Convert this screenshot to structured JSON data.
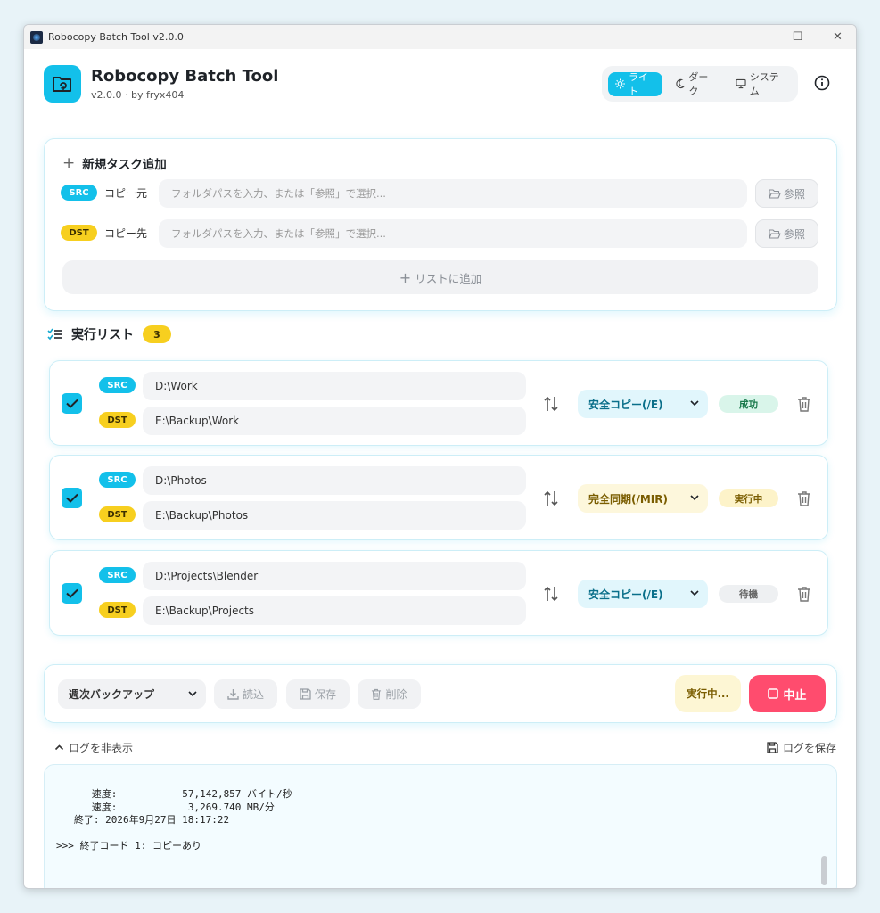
{
  "window": {
    "title": "Robocopy Batch Tool  v2.0.0"
  },
  "header": {
    "title": "Robocopy Batch Tool",
    "subtitle": "v2.0.0 · by fryx404",
    "themes": [
      {
        "label": "ライト",
        "icon": "sun-icon",
        "active": true
      },
      {
        "label": "ダーク",
        "icon": "moon-icon",
        "active": false
      },
      {
        "label": "システム",
        "icon": "monitor-icon",
        "active": false
      }
    ]
  },
  "new_task": {
    "title": "新規タスク追加",
    "src_badge": "SRC",
    "src_label": "コピー元",
    "src_placeholder": "フォルダパスを入力、または「参照」で選択...",
    "dst_badge": "DST",
    "dst_label": "コピー先",
    "dst_placeholder": "フォルダパスを入力、または「参照」で選択...",
    "browse_label": "参照",
    "add_label": "リストに追加"
  },
  "list": {
    "title": "実行リスト",
    "count": "3",
    "jobs": [
      {
        "checked": true,
        "src": "D:\\Work",
        "dst": "E:\\Backup\\Work",
        "mode": "安全コピー(/E)",
        "status": "成功"
      },
      {
        "checked": true,
        "src": "D:\\Photos",
        "dst": "E:\\Backup\\Photos",
        "mode": "完全同期(/MIR)",
        "status": "実行中"
      },
      {
        "checked": true,
        "src": "D:\\Projects\\Blender",
        "dst": "E:\\Backup\\Projects",
        "mode": "安全コピー(/E)",
        "status": "待機"
      }
    ]
  },
  "bottom": {
    "preset": "週次バックアップ",
    "load_label": "読込",
    "save_label": "保存",
    "delete_label": "削除",
    "running_label": "実行中...",
    "stop_label": "中止"
  },
  "log": {
    "toggle_label": "ログを非表示",
    "save_label": "ログを保存",
    "lines": "      速度:           57,142,857 バイト/秒\n      速度:            3,269.740 MB/分\n   終了: 2026年9月27日 18:17:22\n\n>>> 終了コード 1: コピーあり"
  },
  "colors": {
    "accent": "#13c0ea",
    "dst": "#f7cf1f",
    "stop": "#ff4c6e",
    "success": "#1a7a4c"
  }
}
